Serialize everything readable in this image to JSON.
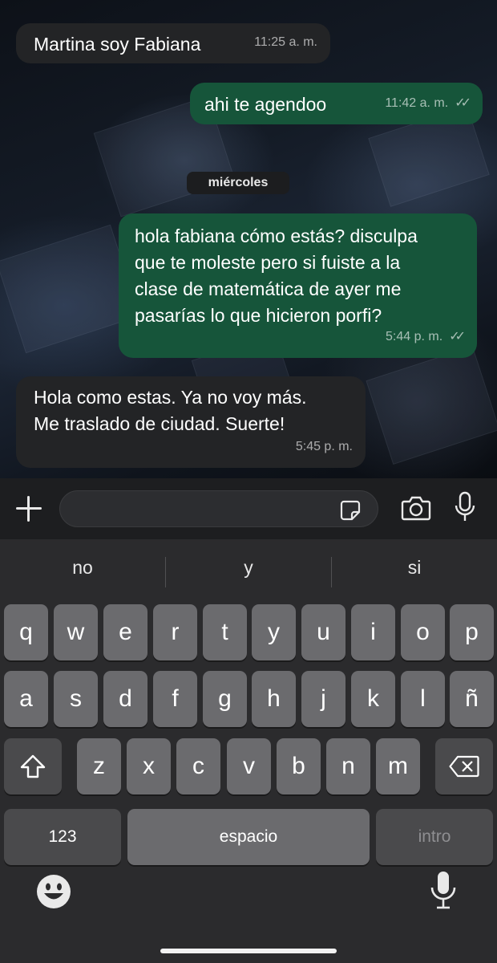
{
  "messages": [
    {
      "direction": "in",
      "text": "Martina soy Fabiana",
      "time": "11:25 a. m."
    },
    {
      "direction": "out",
      "text": "ahi te agendoo",
      "time": "11:42 a. m.",
      "read_ticks": "✓✓"
    },
    {
      "direction": "out",
      "text": "hola fabiana cómo estás? disculpa\nque te moleste pero si fuiste a la\nclase de matemática de ayer me\npasarías lo que hicieron porfi?",
      "time": "5:44 p. m.",
      "read_ticks": "✓✓"
    },
    {
      "direction": "in",
      "text": "Hola como estas. Ya no voy más.\nMe traslado de ciudad. Suerte!",
      "time": "5:45 p. m."
    }
  ],
  "date_divider": "miércoles",
  "composer": {
    "value": "",
    "placeholder": ""
  },
  "icons": {
    "attach": "plus-icon",
    "sticker": "sticker-icon",
    "camera": "camera-icon",
    "mic": "microphone-icon",
    "emoji": "emoji-icon",
    "dictation": "dictation-mic-icon",
    "shift": "shift-icon",
    "backspace": "backspace-icon"
  },
  "colors": {
    "outgoing": "#16553a",
    "incoming": "#232426",
    "keyboard": "#2b2b2d",
    "key": "#6b6b6e"
  },
  "keyboard": {
    "suggestions": [
      "no",
      "y",
      "si"
    ],
    "row1": [
      "q",
      "w",
      "e",
      "r",
      "t",
      "y",
      "u",
      "i",
      "o",
      "p"
    ],
    "row2": [
      "a",
      "s",
      "d",
      "f",
      "g",
      "h",
      "j",
      "k",
      "l",
      "ñ"
    ],
    "row3": [
      "z",
      "x",
      "c",
      "v",
      "b",
      "n",
      "m"
    ],
    "numbers_label": "123",
    "space_label": "espacio",
    "return_label": "intro"
  }
}
